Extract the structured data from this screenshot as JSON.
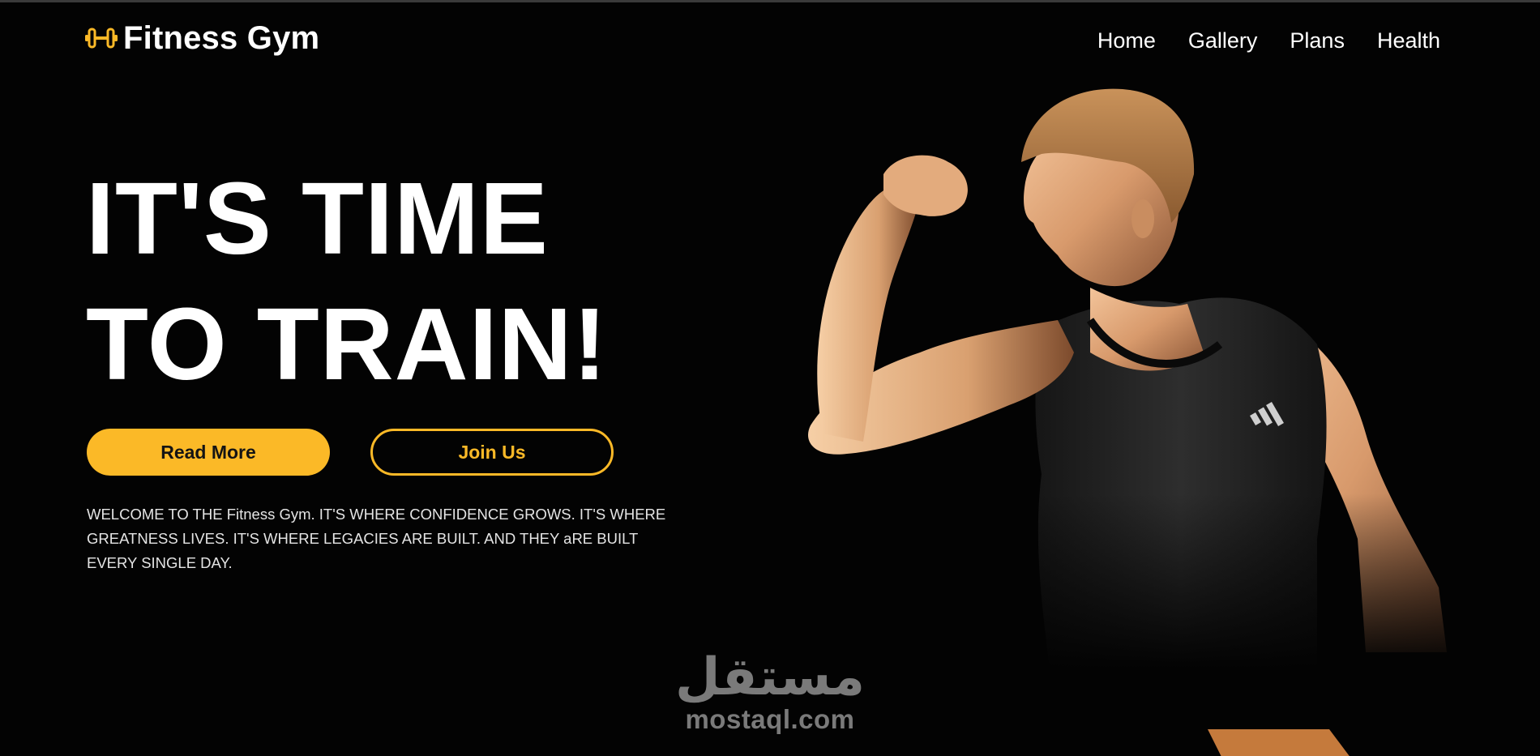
{
  "header": {
    "logo_text": "Fitness Gym",
    "logo_icon": "dumbbell-icon",
    "nav": [
      {
        "label": "Home"
      },
      {
        "label": "Gallery"
      },
      {
        "label": "Plans"
      },
      {
        "label": "Health"
      }
    ]
  },
  "hero": {
    "title_line1": "IT'S TIME",
    "title_line2": "TO TRAIN!",
    "read_more_label": "Read More",
    "join_label": "Join Us",
    "description": "WELCOME TO THE Fitness Gym. IT'S WHERE CONFIDENCE GROWS. IT'S WHERE GREATNESS LIVES. IT'S WHERE LEGACIES ARE BUILT. AND THEY aRE BUILT EVERY SINGLE DAY.",
    "image_subject": "athlete-flexing-bicep"
  },
  "watermark": {
    "arabic": "مستقل",
    "latin": "mostaql.com"
  },
  "colors": {
    "accent": "#fbb927",
    "background": "#030303",
    "text": "#ffffff"
  }
}
